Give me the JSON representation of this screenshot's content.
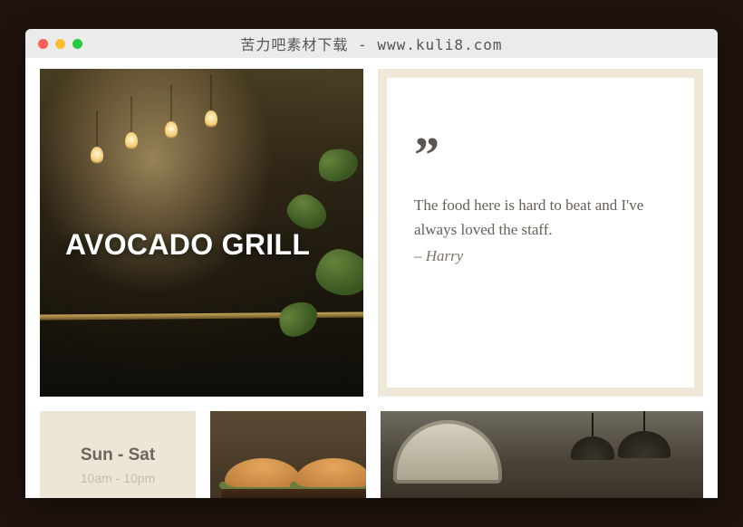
{
  "window": {
    "title": "苦力吧素材下载 - www.kuli8.com"
  },
  "hero": {
    "title": "AVOCADO GRILL"
  },
  "quote": {
    "mark": "”",
    "text": "The food here is hard to beat and I've always loved the staff.",
    "author": "– Harry"
  },
  "hours": {
    "days": "Sun - Sat",
    "time": "10am - 10pm"
  }
}
